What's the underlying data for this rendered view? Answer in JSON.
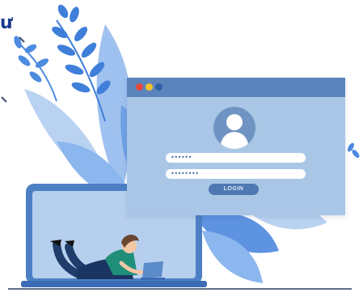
{
  "corner_text": "ư",
  "login": {
    "username_mask": "••••••",
    "password_mask": "••••••••",
    "button_label": "LOGIN"
  },
  "colors": {
    "titlebar": "#5a84bb",
    "window": "#a9c6e6",
    "dot_red": "#e8473e",
    "dot_yellow": "#f3c22b",
    "dot_blue": "#2f5fa8",
    "leaf_dark": "#3f7fd9",
    "leaf_light": "#8bb6ee"
  }
}
